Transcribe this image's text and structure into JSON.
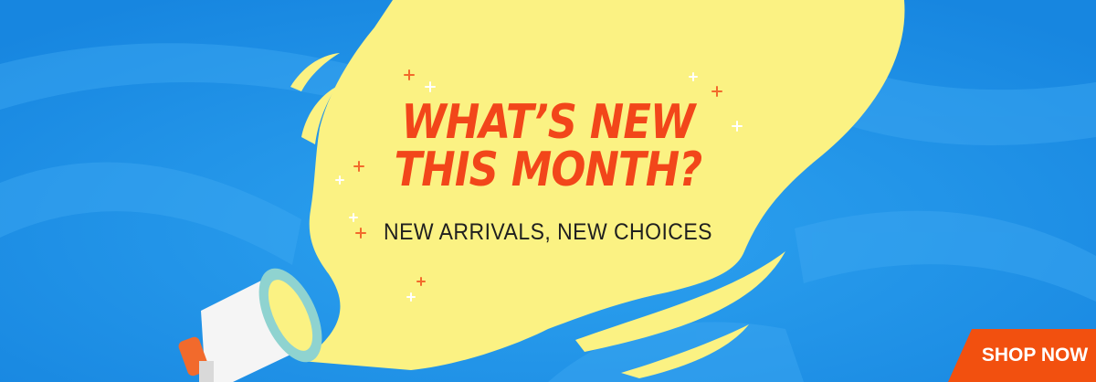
{
  "banner": {
    "headline_line1": "WHAT’S NEW",
    "headline_line2": "THIS MONTH?",
    "subline": "NEW ARRIVALS, NEW CHOICES",
    "cta_label": "SHOP NOW"
  },
  "icons": {
    "megaphone": "megaphone-icon",
    "sparkles": "sparkle-icon"
  },
  "colors": {
    "background": "#1a8fe6",
    "bubble": "#fbf283",
    "headline": "#f2461a",
    "cta": "#f2500f",
    "megaphone_trim": "#f26a2c",
    "megaphone_ring": "#8fd3d0"
  }
}
